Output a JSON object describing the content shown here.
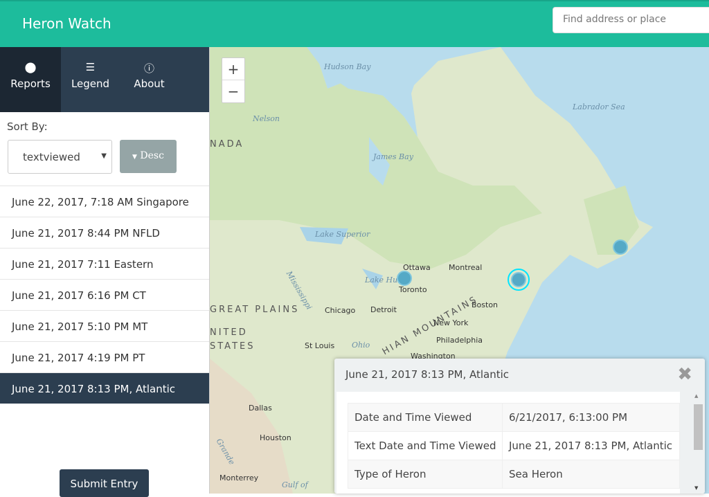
{
  "header": {
    "title": "Heron Watch",
    "search_placeholder": "Find address or place"
  },
  "tabs": [
    {
      "label": "Reports",
      "icon": "map-marker-icon"
    },
    {
      "label": "Legend",
      "icon": "list-icon"
    },
    {
      "label": "About",
      "icon": "info-icon"
    }
  ],
  "sort": {
    "label": "Sort By:",
    "selected": "textviewed",
    "order": "Desc"
  },
  "reports": [
    "June 22, 2017, 7:18 AM Singapore",
    "June 21, 2017 8:44 PM NFLD",
    "June 21, 2017 7:11 Eastern",
    "June 21, 2017 6:16 PM CT",
    "June 21, 2017 5:10 PM MT",
    "June 21, 2017 4:19 PM PT",
    "June 21, 2017 8:13 PM, Atlantic"
  ],
  "submit": "Submit Entry",
  "map": {
    "zoom_in": "+",
    "zoom_out": "−",
    "labels": [
      "Hudson Bay",
      "Nelson",
      "NADA",
      "James Bay",
      "Labrador Sea",
      "Lake Superior",
      "Ottawa",
      "Montreal",
      "Lake Huron",
      "Toronto",
      "Mississippi",
      "GREAT PLAINS",
      "Chicago",
      "Detroit",
      "Boston",
      "New York",
      "Philadelphia",
      "Washington",
      "NITED STATES",
      "St Louis",
      "Ohio",
      "HIAN MOUNTAINS",
      "Dallas",
      "Houston",
      "Monterrey",
      "Gulf of",
      "Grande"
    ]
  },
  "popup": {
    "title": "June 21, 2017 8:13 PM, Atlantic",
    "rows": [
      [
        "Date and Time Viewed",
        "6/21/2017, 6:13:00 PM"
      ],
      [
        "Text Date and Time Viewed",
        "June 21, 2017 8:13 PM, Atlantic"
      ],
      [
        "Type of Heron",
        "Sea Heron"
      ]
    ]
  },
  "colors": {
    "header": "#1dbc9c",
    "sidebar_dark": "#2c3e50",
    "marker": "#55a9c6",
    "selected": "#00e5ff"
  }
}
